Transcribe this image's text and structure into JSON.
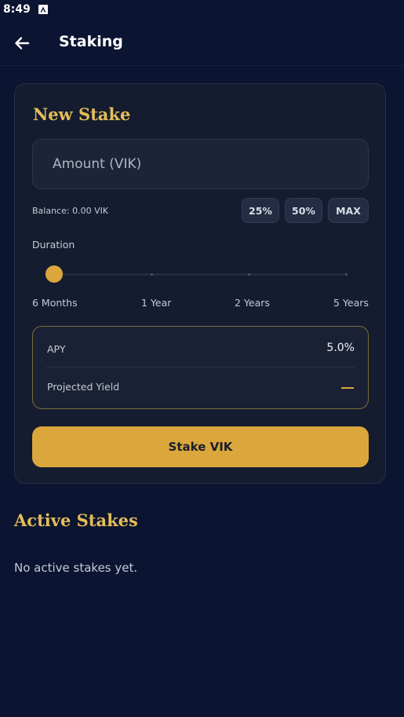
{
  "status_bar": {
    "time": "8:49",
    "app_icon": "a-icon"
  },
  "app_bar": {
    "back_icon": "arrow-left-icon",
    "title": "Staking"
  },
  "new_stake": {
    "title": "New Stake",
    "amount_placeholder": "Amount (VIK)",
    "amount_value": "",
    "balance": "Balance: 0.00 VIK",
    "percent_buttons": [
      "25%",
      "50%",
      "MAX"
    ],
    "duration_label": "Duration",
    "duration_options": [
      "6 Months",
      "1 Year",
      "2 Years",
      "5 Years"
    ],
    "duration_selected": "6 Months",
    "apy_label": "APY",
    "apy_value": "5.0%",
    "projected_label": "Projected Yield",
    "projected_value": "—",
    "stake_button": "Stake VIK"
  },
  "active_stakes": {
    "title": "Active Stakes",
    "empty_message": "No active stakes yet."
  },
  "colors": {
    "background": "#0b1430",
    "card": "#151c30",
    "accent": "#dba73c",
    "heading_gold": "#e3bd58"
  }
}
